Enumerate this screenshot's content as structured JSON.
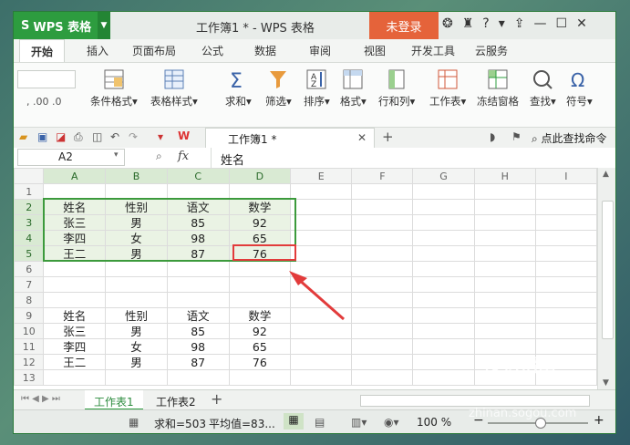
{
  "titlebar": {
    "app_name": "WPS 表格",
    "doc_title": "工作簿1 * - WPS 表格",
    "login_label": "未登录"
  },
  "ribbon_tabs": [
    "开始",
    "插入",
    "页面布局",
    "公式",
    "数据",
    "审阅",
    "视图",
    "开发工具",
    "云服务"
  ],
  "ribbon_buttons": [
    {
      "label": "条件格式",
      "icon": "conditional-format-icon"
    },
    {
      "label": "表格样式",
      "icon": "table-style-icon"
    },
    {
      "label": "求和",
      "icon": "sum-icon"
    },
    {
      "label": "筛选",
      "icon": "filter-icon"
    },
    {
      "label": "排序",
      "icon": "sort-icon"
    },
    {
      "label": "格式",
      "icon": "format-icon"
    },
    {
      "label": "行和列",
      "icon": "row-col-icon"
    },
    {
      "label": "工作表",
      "icon": "worksheet-icon"
    },
    {
      "label": "冻结窗格",
      "icon": "freeze-icon"
    },
    {
      "label": "查找",
      "icon": "find-icon"
    },
    {
      "label": "符号",
      "icon": "symbol-icon"
    }
  ],
  "quick_access": {
    "doc_tab": "工作簿1 *",
    "search_label": "点此查找命令"
  },
  "formula_bar": {
    "cell_ref": "A2",
    "fx": "fx",
    "content": "姓名"
  },
  "columns": [
    "A",
    "B",
    "C",
    "D",
    "E",
    "F",
    "G",
    "H",
    "I"
  ],
  "rows": [
    [
      "",
      "",
      "",
      ""
    ],
    [
      "姓名",
      "性别",
      "语文",
      "数学"
    ],
    [
      "张三",
      "男",
      "85",
      "92"
    ],
    [
      "李四",
      "女",
      "98",
      "65"
    ],
    [
      "王二",
      "男",
      "87",
      "76"
    ],
    [
      "",
      "",
      "",
      ""
    ],
    [
      "",
      "",
      "",
      ""
    ],
    [
      "",
      "",
      "",
      ""
    ],
    [
      "姓名",
      "性别",
      "语文",
      "数学"
    ],
    [
      "张三",
      "男",
      "85",
      "92"
    ],
    [
      "李四",
      "女",
      "98",
      "65"
    ],
    [
      "王二",
      "男",
      "87",
      "76"
    ],
    [
      "",
      "",
      "",
      ""
    ]
  ],
  "sheets": [
    "工作表1",
    "工作表2"
  ],
  "status": {
    "sum": "求和=503",
    "avg": "平均值=83...",
    "zoom": "100 %"
  },
  "watermark": {
    "brand": "搜狗指南",
    "url": "zhinan.sogou.com"
  },
  "colors": {
    "accent": "#2d9c3f",
    "login": "#e5633a",
    "highlight_border": "#e23b3b"
  }
}
